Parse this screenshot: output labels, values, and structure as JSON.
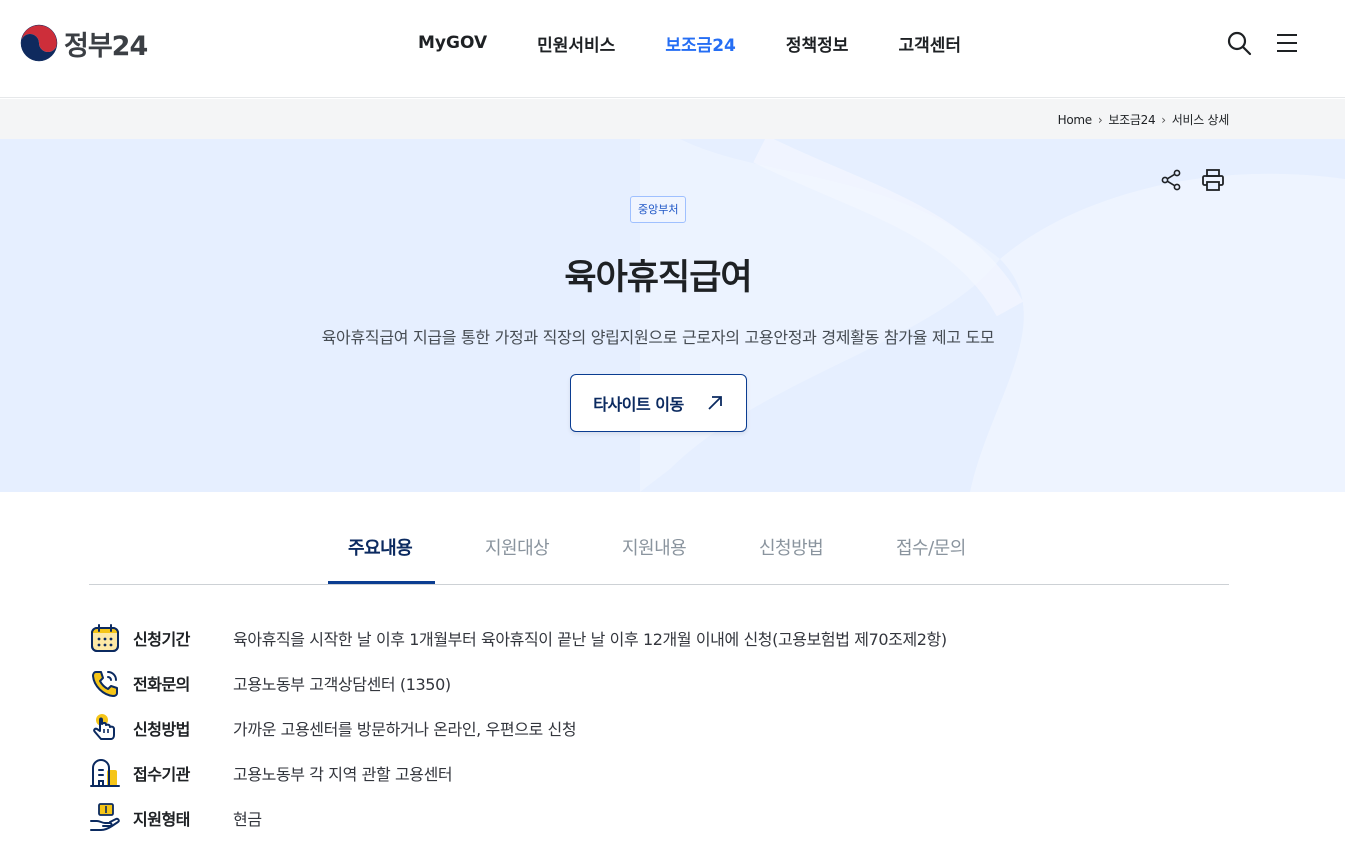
{
  "header": {
    "logo_text": "정부24",
    "nav": [
      "MyGOV",
      "민원서비스",
      "보조금24",
      "정책정보",
      "고객센터"
    ],
    "active_nav": "보조금24"
  },
  "breadcrumb": [
    "Home",
    "보조금24",
    "서비스 상세"
  ],
  "hero": {
    "badge": "중앙부처",
    "title": "육아휴직급여",
    "description": "육아휴직급여 지급을 통한 가정과 직장의 양립지원으로 근로자의 고용안정과 경제활동 참가율 제고 도모",
    "button_label": "타사이트 이동"
  },
  "tabs": [
    "주요내용",
    "지원대상",
    "지원내용",
    "신청방법",
    "접수/문의"
  ],
  "active_tab": "주요내용",
  "info_rows": [
    {
      "icon": "calendar-icon",
      "label": "신청기간",
      "value": "육아휴직을 시작한 날 이후 1개월부터 육아휴직이 끝난 날 이후 12개월 이내에 신청(고용보험법 제70조제2항)"
    },
    {
      "icon": "phone-icon",
      "label": "전화문의",
      "value": "고용노동부 고객상담센터 (1350)"
    },
    {
      "icon": "hand-pointer-icon",
      "label": "신청방법",
      "value": "가까운 고용센터를 방문하거나 온라인, 우편으로 신청"
    },
    {
      "icon": "building-icon",
      "label": "접수기관",
      "value": "고용노동부 각 지역 관할 고용센터"
    },
    {
      "icon": "cash-hand-icon",
      "label": "지원형태",
      "value": "현금"
    }
  ],
  "colors": {
    "primary": "#256ef4",
    "navy": "#0b3d91",
    "hero_bg": "#e6efff",
    "accent_yellow": "#f5c518"
  }
}
